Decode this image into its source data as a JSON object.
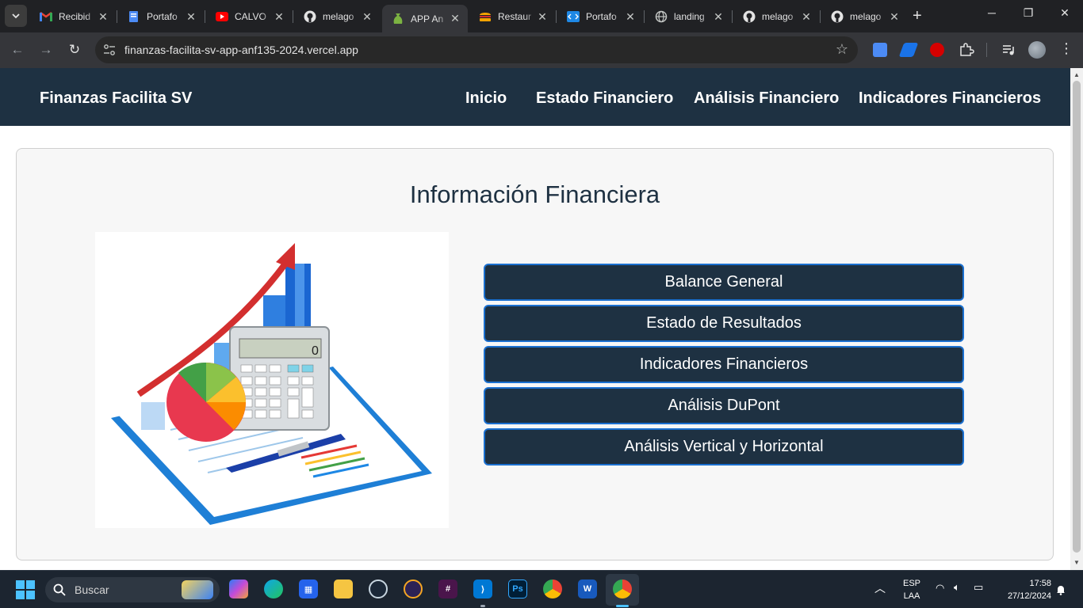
{
  "browser": {
    "tabs": [
      {
        "title": "Recibid",
        "icon": "gmail-icon",
        "active": false
      },
      {
        "title": "Portafo",
        "icon": "document-icon",
        "active": false
      },
      {
        "title": "CALVO",
        "icon": "youtube-icon",
        "active": false
      },
      {
        "title": "melago",
        "icon": "github-icon",
        "active": false
      },
      {
        "title": "APP An",
        "icon": "app-icon",
        "active": true
      },
      {
        "title": "Restaur",
        "icon": "burger-icon",
        "active": false
      },
      {
        "title": "Portafo",
        "icon": "code-icon",
        "active": false
      },
      {
        "title": "landing",
        "icon": "globe-icon",
        "active": false
      },
      {
        "title": "melago",
        "icon": "github-icon",
        "active": false
      },
      {
        "title": "melago",
        "icon": "github-icon",
        "active": false
      }
    ],
    "url": "finanzas-facilita-sv-app-anf135-2024.vercel.app"
  },
  "site": {
    "brand": "Finanzas Facilita SV",
    "nav": [
      "Inicio",
      "Estado Financiero",
      "Análisis Financiero",
      "Indicadores Financieros"
    ],
    "title": "Información Financiera",
    "buttons": [
      "Balance General",
      "Estado de Resultados",
      "Indicadores Financieros",
      "Análisis DuPont",
      "Análisis Vertical y Horizontal"
    ],
    "accent": "#1e3142",
    "button_border": "#1a6fcf"
  },
  "taskbar": {
    "search_label": "Buscar",
    "language": "ESP",
    "layout": "LAA",
    "time": "17:58",
    "date": "27/12/2024"
  }
}
